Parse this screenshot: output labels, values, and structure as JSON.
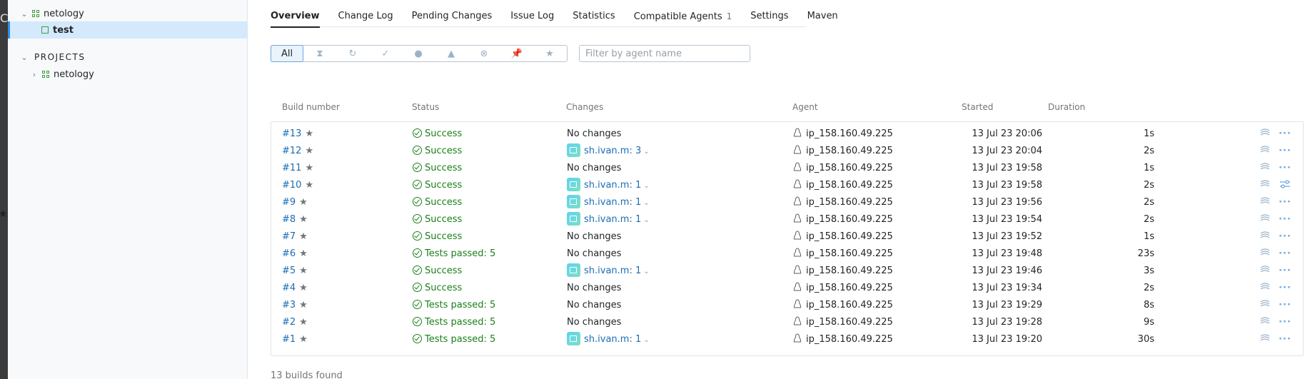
{
  "edge": {
    "glyph": "C",
    "star": "★"
  },
  "sidebar": {
    "top_project": {
      "label": "netology",
      "expanded_icon": "chevron-down-icon"
    },
    "selected_build_type": {
      "label": "test"
    },
    "section_label": "PROJECTS",
    "projects": [
      {
        "label": "netology",
        "collapsed_icon": "chevron-right-icon"
      }
    ]
  },
  "tabs": [
    {
      "label": "Overview",
      "active": true
    },
    {
      "label": "Change Log"
    },
    {
      "label": "Pending Changes"
    },
    {
      "label": "Issue Log"
    },
    {
      "label": "Statistics"
    },
    {
      "label": "Compatible Agents",
      "count": "1"
    },
    {
      "label": "Settings"
    },
    {
      "label": "Maven"
    }
  ],
  "filters": {
    "all_label": "All",
    "icons": [
      "queued-icon",
      "running-icon",
      "success-icon",
      "failed-icon",
      "warning-icon",
      "canceled-icon",
      "pinned-icon",
      "starred-icon"
    ],
    "agent_placeholder": "Filter by agent name"
  },
  "table": {
    "headers": {
      "build_number": "Build number",
      "status": "Status",
      "changes": "Changes",
      "agent": "Agent",
      "started": "Started",
      "duration": "Duration"
    },
    "rows": [
      {
        "num": "#13",
        "status": "Success",
        "changes": "No changes",
        "user": "",
        "agent": "ip_158.160.49.225",
        "started": "13 Jul 23 20:06",
        "duration": "1s"
      },
      {
        "num": "#12",
        "status": "Success",
        "changes": "",
        "user": "sh.ivan.m: 3",
        "agent": "ip_158.160.49.225",
        "started": "13 Jul 23 20:04",
        "duration": "2s"
      },
      {
        "num": "#11",
        "status": "Success",
        "changes": "No changes",
        "user": "",
        "agent": "ip_158.160.49.225",
        "started": "13 Jul 23 19:58",
        "duration": "1s"
      },
      {
        "num": "#10",
        "status": "Success",
        "changes": "",
        "user": "sh.ivan.m: 1",
        "agent": "ip_158.160.49.225",
        "started": "13 Jul 23 19:58",
        "duration": "2s"
      },
      {
        "num": "#9",
        "status": "Success",
        "changes": "",
        "user": "sh.ivan.m: 1",
        "agent": "ip_158.160.49.225",
        "started": "13 Jul 23 19:56",
        "duration": "2s"
      },
      {
        "num": "#8",
        "status": "Success",
        "changes": "",
        "user": "sh.ivan.m: 1",
        "agent": "ip_158.160.49.225",
        "started": "13 Jul 23 19:54",
        "duration": "2s"
      },
      {
        "num": "#7",
        "status": "Success",
        "changes": "No changes",
        "user": "",
        "agent": "ip_158.160.49.225",
        "started": "13 Jul 23 19:52",
        "duration": "1s"
      },
      {
        "num": "#6",
        "status": "Tests passed: 5",
        "changes": "No changes",
        "user": "",
        "agent": "ip_158.160.49.225",
        "started": "13 Jul 23 19:48",
        "duration": "23s"
      },
      {
        "num": "#5",
        "status": "Success",
        "changes": "",
        "user": "sh.ivan.m: 1",
        "agent": "ip_158.160.49.225",
        "started": "13 Jul 23 19:46",
        "duration": "3s"
      },
      {
        "num": "#4",
        "status": "Success",
        "changes": "No changes",
        "user": "",
        "agent": "ip_158.160.49.225",
        "started": "13 Jul 23 19:34",
        "duration": "2s"
      },
      {
        "num": "#3",
        "status": "Tests passed: 5",
        "changes": "No changes",
        "user": "",
        "agent": "ip_158.160.49.225",
        "started": "13 Jul 23 19:29",
        "duration": "8s"
      },
      {
        "num": "#2",
        "status": "Tests passed: 5",
        "changes": "No changes",
        "user": "",
        "agent": "ip_158.160.49.225",
        "started": "13 Jul 23 19:28",
        "duration": "9s"
      },
      {
        "num": "#1",
        "status": "Tests passed: 5",
        "changes": "",
        "user": "sh.ivan.m: 1",
        "agent": "ip_158.160.49.225",
        "started": "13 Jul 23 19:20",
        "duration": "30s"
      }
    ],
    "row_actions": {
      "artifacts_icon": "artifacts-icon",
      "more_icon": "more-icon",
      "alt_icon": "tune-icon"
    }
  },
  "footer": {
    "summary": "13 builds found"
  },
  "colors": {
    "link": "#1b6db3",
    "success": "#1a7f1a",
    "accent": "#2d8ee8",
    "selected_bg": "#d4e9fb"
  }
}
